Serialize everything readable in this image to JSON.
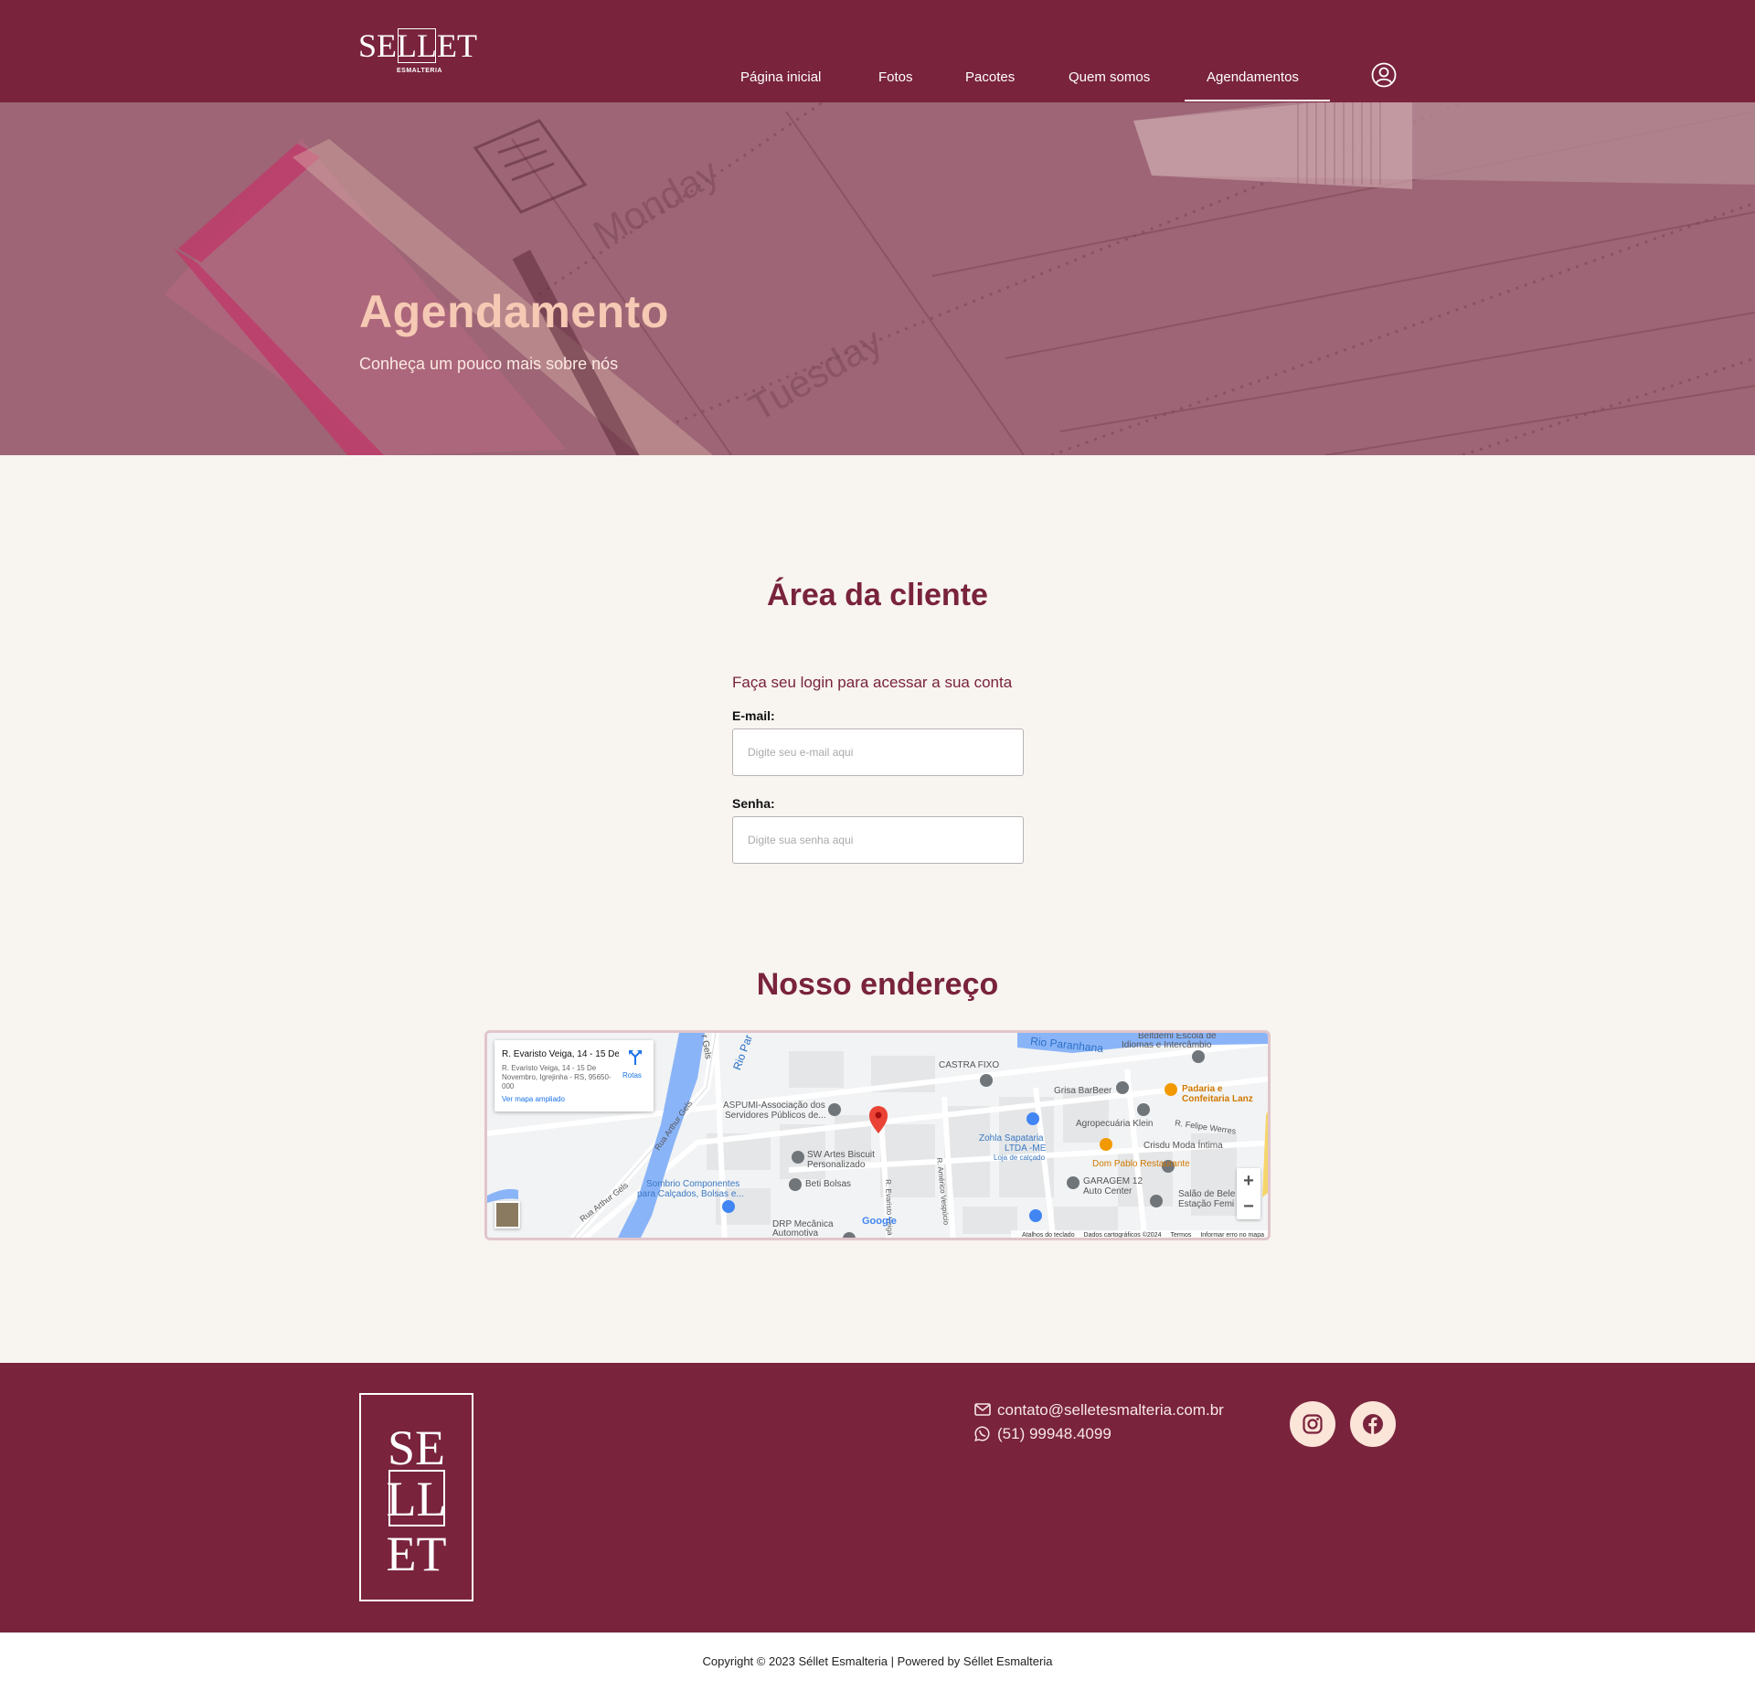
{
  "brand": {
    "name": "SELLET",
    "tagline": "ESMALTERIA"
  },
  "nav": {
    "items": [
      {
        "label": "Página inicial"
      },
      {
        "label": "Fotos"
      },
      {
        "label": "Pacotes"
      },
      {
        "label": "Quem somos"
      },
      {
        "label": "Agendamentos",
        "active": true
      }
    ],
    "user_icon": "user-circle-icon"
  },
  "hero": {
    "title": "Agendamento",
    "subtitle": "Conheça um pouco mais sobre nós"
  },
  "client_area": {
    "title": "Área da cliente",
    "lead": "Faça seu login para acessar a sua conta",
    "email_label": "E-mail:",
    "email_placeholder": "Digite seu e-mail aqui",
    "email_value": "",
    "password_label": "Senha:",
    "password_placeholder": "Digite sua senha aqui",
    "password_value": ""
  },
  "address": {
    "title": "Nosso endereço",
    "map": {
      "card_title": "R. Evaristo Veiga, 14 - 15 De N...",
      "card_address": "R. Evaristo Veiga, 14 - 15 De Novembro, Igrejinha - RS, 95650-000",
      "card_link": "Ver mapa ampliado",
      "directions": "Rotas",
      "labels": {
        "rio_paranhana": "Rio Paranhana",
        "rio_par": "Rio Par",
        "gels": "r Gels",
        "escola": "Beltdeml Escola de",
        "idiomas": "Idiomas e Intercâmbio",
        "castra": "CASTRA FIXO",
        "grisa": "Grisa BarBeer",
        "padaria1": "Padaria e",
        "padaria2": "Confeitaria Lanz",
        "aspumi1": "ASPUMI-Associação dos",
        "aspumi2": "Servidores Públicos de...",
        "agro": "Agropecuária Klein",
        "felipe": "R. Felipe Werres",
        "rua_arthur_1": "Rua Arthur Gels",
        "rua_arthur_2": "Rua Arthur Gels",
        "zohla1": "Zohla Sapataria",
        "zohla2": "LTDA -ME",
        "zohla3": "Loja de calçado",
        "crisdu": "Crisdu Moda Íntima",
        "swartes1": "SW Artes Biscuit",
        "swartes2": "Personalizado",
        "dompablo": "Dom Pablo Restaurante",
        "beti": "Beti Bolsas",
        "garagem1": "GARAGEM 12",
        "garagem2": "Auto Center",
        "sombrio1": "Sombrio Componentes",
        "sombrio2": "para Calçados, Bolsas e...",
        "salao1": "Salão de Bele",
        "salao2": "Estação Femi",
        "evaristo": "R. Evaristo Veiga",
        "americo": "R. Américo Vespúcio",
        "drp1": "DRP Mecânica",
        "drp2": "Automotiva"
      },
      "google": "Google",
      "zoom_in": "+",
      "zoom_out": "−",
      "attribution": [
        "Atalhos do teclado",
        "Dados cartográficos ©2024",
        "Termos",
        "Informar erro no mapa"
      ]
    }
  },
  "footer": {
    "logo_lines": [
      "SE",
      "LL",
      "ET"
    ],
    "email": "contato@selletesmalteria.com.br",
    "phone": "(51) 99948.4099",
    "copyright": "Copyright © 2023 Séllet Esmalteria | Powered by Séllet Esmalteria"
  },
  "colors": {
    "brand": "#79233d",
    "accent": "#f6c9b4",
    "background": "#f8f4f0"
  }
}
